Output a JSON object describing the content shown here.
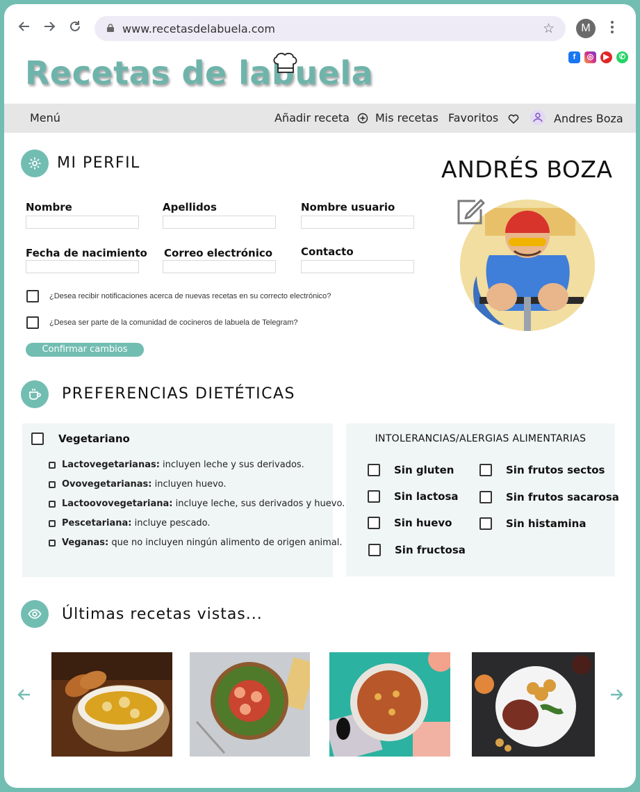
{
  "browser": {
    "url": "www.recetasdelabuela.com",
    "profile_initial": "M"
  },
  "brand": {
    "logo_text": "Recetas de labuela",
    "accent_color": "#72bdb2"
  },
  "socials": [
    "facebook-icon",
    "instagram-icon",
    "youtube-icon",
    "whatsapp-icon"
  ],
  "nav": {
    "menu": "Menú",
    "add_recipe": "Añadir receta",
    "my_recipes": "Mis recetas",
    "favorites": "Favoritos",
    "user": "Andres Boza"
  },
  "profile": {
    "section_title": "MI PERFIL",
    "display_name": "ANDRÉS BOZA",
    "fields": {
      "nombre": "Nombre",
      "apellidos": "Apellidos",
      "usuario": "Nombre usuario",
      "nacimiento": "Fecha de nacimiento",
      "correo": "Correo electrónico",
      "contacto": "Contacto"
    },
    "check_email": "¿Desea recibir notificaciones acerca de nuevas recetas en su correcto electrónico?",
    "check_telegram": "¿Desea ser parte de la comunidad de cocineros de labuela de Telegram?",
    "confirm": "Confirmar cambios"
  },
  "diet": {
    "section_title": "PREFERENCIAS DIETÉTICAS",
    "vegetarian": "Vegetariano",
    "types": [
      {
        "name": "Lactovegetarianas:",
        "desc": " incluyen leche y sus derivados."
      },
      {
        "name": "Ovovegetarianas:",
        "desc": " incluyen huevo."
      },
      {
        "name": "Lactoovovegetariana:",
        "desc": " incluye leche, sus derivados y huevo."
      },
      {
        "name": "Pescetariana:",
        "desc": " incluye pescado."
      },
      {
        "name": "Veganas:",
        "desc": " que no incluyen ningún alimento de origen animal."
      }
    ],
    "allergy_title": "INTOLERANCIAS/ALERGIAS ALIMENTARIAS",
    "allergies_left": [
      "Sin gluten",
      "Sin lactosa",
      "Sin huevo",
      "Sin fructosa"
    ],
    "allergies_right": [
      "Sin frutos sectos",
      "Sin frutos sacarosa",
      "Sin histamina"
    ]
  },
  "recent": {
    "section_title": "Últimas recetas vistas..."
  }
}
